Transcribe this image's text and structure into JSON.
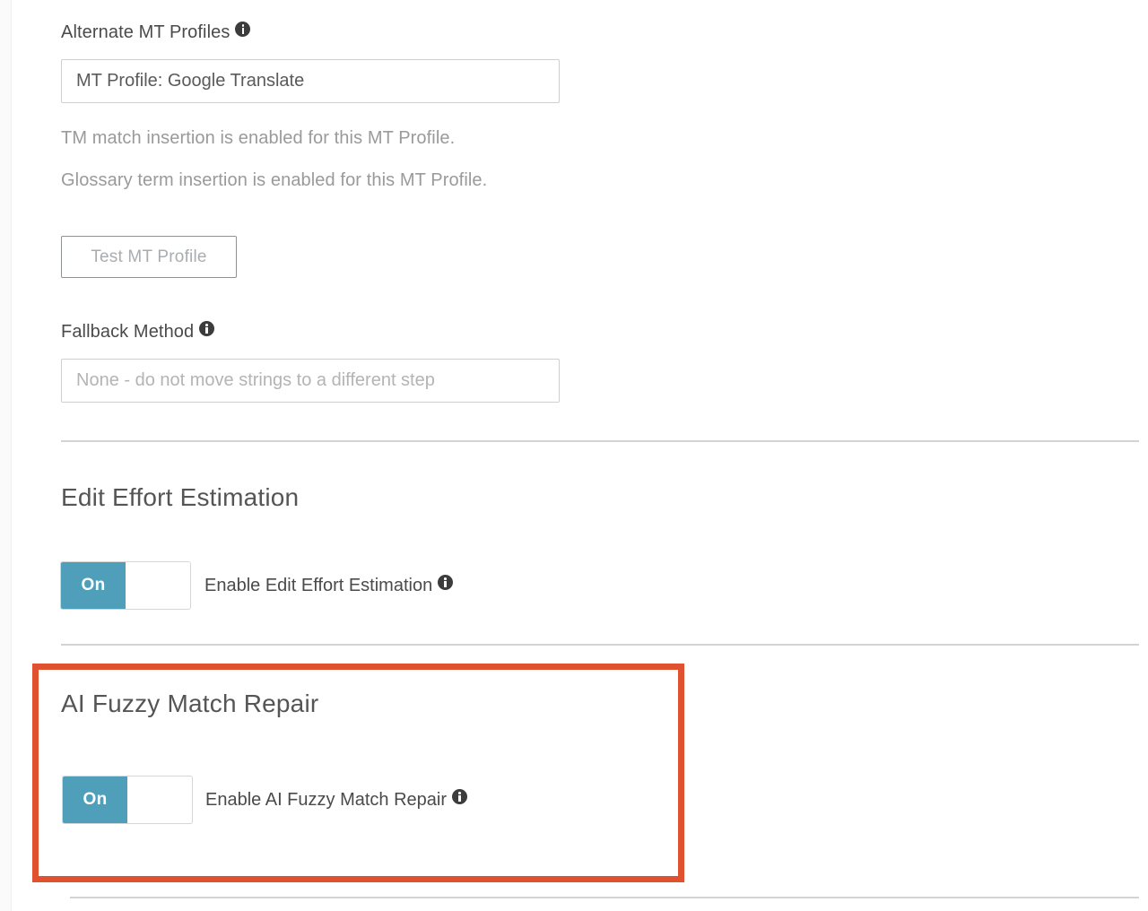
{
  "alternate_mt_profiles": {
    "label": "Alternate MT Profiles",
    "info_icon": "info-icon",
    "value": "MT Profile: Google Translate",
    "placeholder": "MT Profile: Google Translate"
  },
  "mt_profile_notes": [
    "TM match insertion is enabled for this MT Profile.",
    "Glossary term insertion is enabled for this MT Profile."
  ],
  "test_mt_profile": {
    "label": "Test MT Profile"
  },
  "fallback_method": {
    "label": "Fallback Method",
    "info_icon": "info-icon",
    "value": "",
    "placeholder": "None - do not move strings to a different step"
  },
  "edit_effort_estimation": {
    "heading": "Edit Effort Estimation",
    "toggle": {
      "state_label": "On",
      "state": "on"
    },
    "toggle_description": "Enable Edit Effort Estimation",
    "info_icon": "info-icon"
  },
  "ai_fuzzy_match_repair": {
    "heading": "AI Fuzzy Match Repair",
    "toggle": {
      "state_label": "On",
      "state": "on"
    },
    "toggle_description": "Enable AI Fuzzy Match Repair",
    "info_icon": "info-icon",
    "highlighted": true
  },
  "colors": {
    "toggle_on": "#4f9fbb",
    "highlight_border": "#e0512f",
    "divider": "#d3d3d3",
    "label_text": "#4a4a4a",
    "helper_text": "#9a9a9a",
    "heading_text": "#555555",
    "input_border": "#cfcfcf",
    "button_border": "#8d9295",
    "button_text": "#a9adb0",
    "placeholder_text": "#b4b4b4"
  }
}
